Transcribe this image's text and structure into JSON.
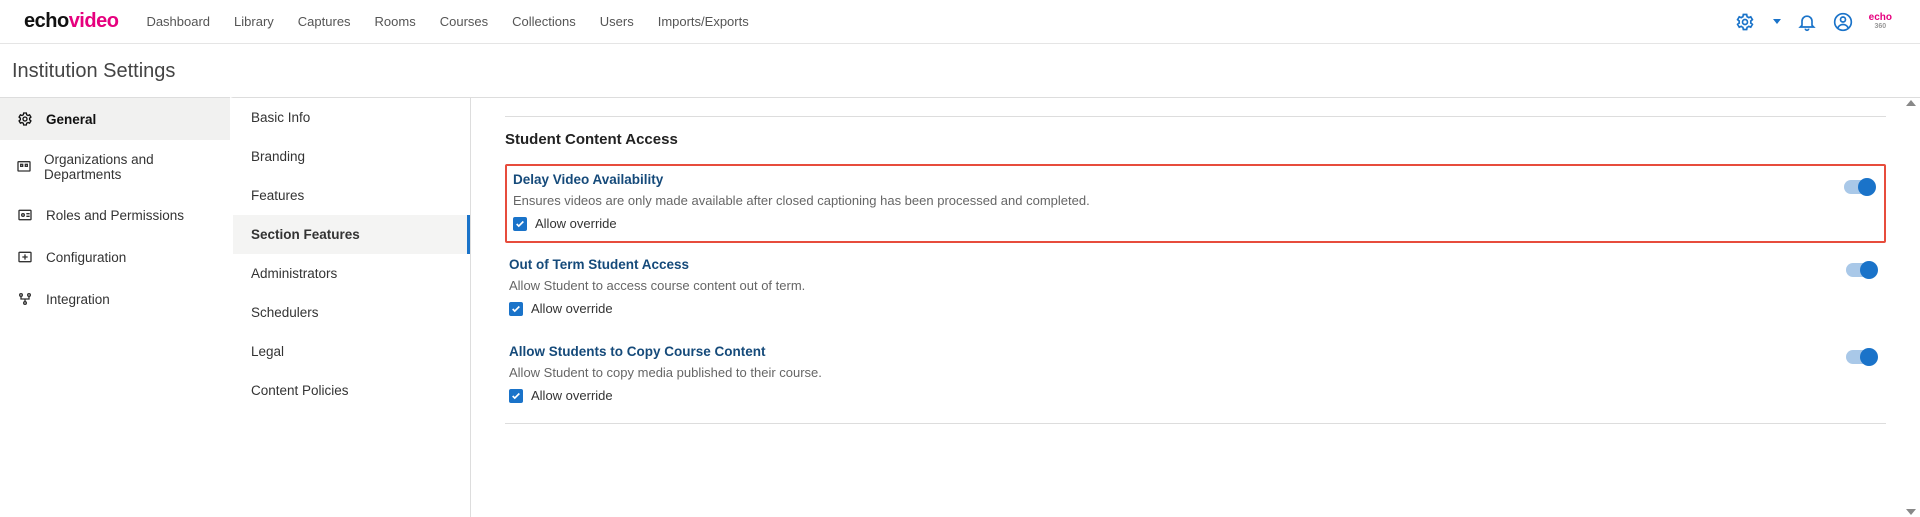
{
  "logo": {
    "part1": "echo",
    "part2": "video"
  },
  "topnav": [
    "Dashboard",
    "Library",
    "Captures",
    "Rooms",
    "Courses",
    "Collections",
    "Users",
    "Imports/Exports"
  ],
  "mini": {
    "line1": "echo",
    "line2": "360"
  },
  "page_title": "Institution Settings",
  "left_nav": [
    {
      "label": "General"
    },
    {
      "label": "Organizations and Departments"
    },
    {
      "label": "Roles and Permissions"
    },
    {
      "label": "Configuration"
    },
    {
      "label": "Integration"
    }
  ],
  "mid_nav": [
    "Basic Info",
    "Branding",
    "Features",
    "Section Features",
    "Administrators",
    "Schedulers",
    "Legal",
    "Content Policies"
  ],
  "section_heading": "Student Content Access",
  "settings": [
    {
      "title": "Delay Video Availability",
      "desc": "Ensures videos are only made available after closed captioning has been processed and completed.",
      "override": "Allow override"
    },
    {
      "title": "Out of Term Student Access",
      "desc": "Allow Student to access course content out of term.",
      "override": "Allow override"
    },
    {
      "title": "Allow Students to Copy Course Content",
      "desc": "Allow Student to copy media published to their course.",
      "override": "Allow override"
    }
  ]
}
